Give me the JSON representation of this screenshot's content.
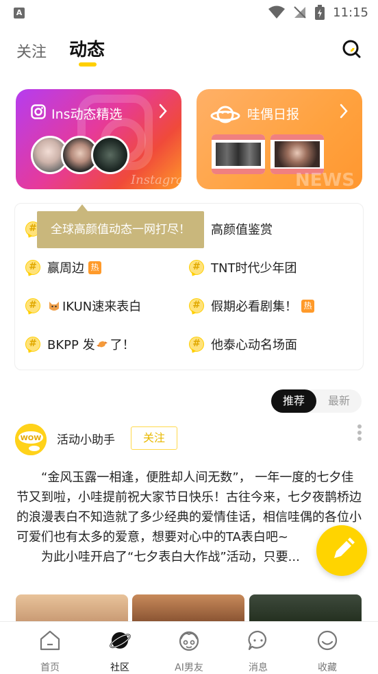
{
  "status_bar": {
    "time": "11:15",
    "app_badge": "A"
  },
  "header": {
    "tab_follow": "关注",
    "tab_feed": "动态"
  },
  "banners": [
    {
      "title": "Ins动态精选",
      "watermark": "Instagram"
    },
    {
      "title": "哇偶日报",
      "watermark": "NEWS"
    }
  ],
  "tooltip": "全球高颜值动态一网打尽！",
  "topics": [
    {
      "label": "高颜值鉴赏",
      "hot": ""
    },
    {
      "label": "赢周边",
      "hot": "热"
    },
    {
      "label": "TNT时代少年团",
      "hot": ""
    },
    {
      "label": "IKUN速来表白",
      "hot": ""
    },
    {
      "label": "假期必看剧集！",
      "hot": "热"
    },
    {
      "label": "BKPP 发",
      "suffix": "了！",
      "hot": ""
    },
    {
      "label": "他泰心动名场面",
      "hot": ""
    }
  ],
  "topic_hash": "#",
  "sort": {
    "recommended": "推荐",
    "latest": "最新"
  },
  "post": {
    "author": "活动小助手",
    "follow_label": "关注",
    "paragraph1": "“金风玉露一相逢，便胜却人间无数”， 一年一度的七夕佳节又到啦，小哇提前祝大家节日快乐！古往今来，七夕夜鹊桥边的浪漫表白不知造就了多少经典的爱情佳话，相信哇偶的各位小可爱们也有太多的爱意，想要对心中的TA表白吧~",
    "paragraph2": "为此小哇开启了“七夕表白大作战”活动，只要..."
  },
  "bottom_nav": [
    {
      "label": "首页",
      "icon": "home-icon"
    },
    {
      "label": "社区",
      "icon": "planet-icon"
    },
    {
      "label": "AI男友",
      "icon": "boyfriend-icon"
    },
    {
      "label": "消息",
      "icon": "message-icon"
    },
    {
      "label": "收藏",
      "icon": "favorite-icon"
    }
  ],
  "colors": {
    "accent": "#ffcf00",
    "hot": "#ff9a2a",
    "tooltip": "#c9b77c"
  }
}
